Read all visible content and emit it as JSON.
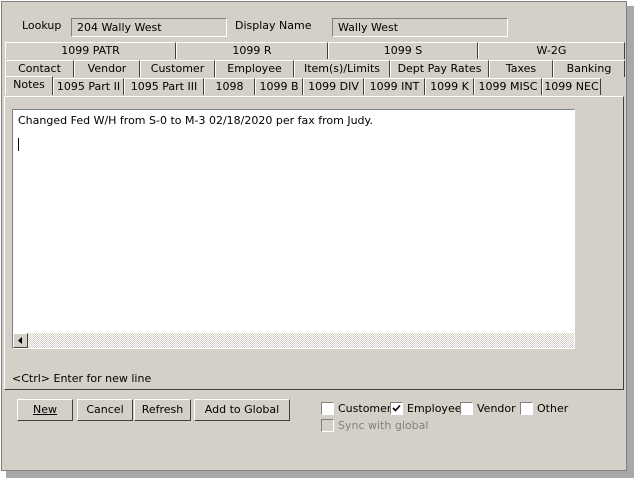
{
  "header": {
    "lookup_label": "Lookup",
    "lookup_value": "204 Wally West",
    "display_name_label": "Display Name",
    "display_name_value": "Wally West"
  },
  "tabs": {
    "row1": [
      "1099 PATR",
      "1099 R",
      "1099 S",
      "W-2G"
    ],
    "row2": [
      "Contact",
      "Vendor",
      "Customer",
      "Employee",
      "Item(s)/Limits",
      "Dept Pay Rates",
      "Taxes",
      "Banking"
    ],
    "row3": [
      "Notes",
      "1095 Part II",
      "1095 Part III",
      "1098",
      "1099 B",
      "1099 DIV",
      "1099 INT",
      "1099 K",
      "1099 MISC",
      "1099 NEC"
    ],
    "active": "Notes"
  },
  "notes": {
    "text": "Changed Fed W/H from S-0 to M-3 02/18/2020 per fax from Judy.",
    "hint": "<Ctrl> Enter for new line"
  },
  "buttons": {
    "new": "New",
    "cancel": "Cancel",
    "refresh": "Refresh",
    "add_to_global": "Add to Global"
  },
  "checkboxes": {
    "customer": {
      "label": "Customer",
      "checked": false
    },
    "employee": {
      "label": "Employee",
      "checked": true
    },
    "vendor": {
      "label": "Vendor",
      "checked": false
    },
    "other": {
      "label": "Other",
      "checked": false
    },
    "sync": {
      "label": "Sync with global",
      "checked": false,
      "enabled": false
    }
  },
  "icons": {
    "scroll_left": "left-arrow-icon",
    "check": "checkmark-icon"
  }
}
